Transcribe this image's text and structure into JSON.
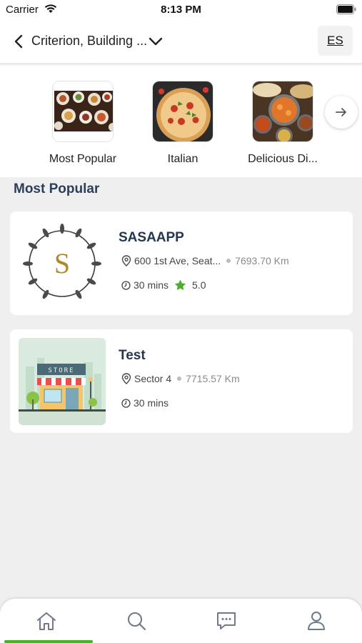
{
  "status": {
    "carrier": "Carrier",
    "time": "8:13 PM"
  },
  "header": {
    "location": "Criterion, Building ...",
    "language": "ES"
  },
  "categories": [
    {
      "label": "Most Popular"
    },
    {
      "label": "Italian"
    },
    {
      "label": "Delicious Di..."
    }
  ],
  "section": {
    "title": "Most Popular"
  },
  "restaurants": [
    {
      "name": "SASAAPP",
      "logo_letter": "S",
      "address": "600 1st Ave, Seat...",
      "distance": "7693.70 Km",
      "time": "30 mins",
      "rating": "5.0"
    },
    {
      "name": "Test",
      "store_sign": "STORE",
      "address": "Sector 4",
      "distance": "7715.57 Km",
      "time": "30 mins"
    }
  ],
  "nav": [
    "home-icon",
    "search-icon",
    "chat-icon",
    "profile-icon"
  ],
  "colors": {
    "accent_green": "#4caf2c",
    "title_navy": "#243650",
    "star": "#4caf2c"
  }
}
